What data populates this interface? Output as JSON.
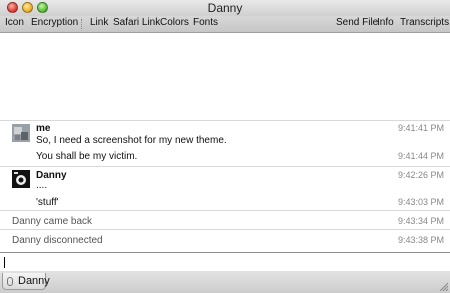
{
  "window": {
    "title": "Danny"
  },
  "toolbar": {
    "items": [
      "Icon",
      "Encryption",
      "Link",
      "Safari Link",
      "Colors",
      "Fonts",
      "Send File",
      "Info",
      "Transcripts"
    ]
  },
  "transcript": {
    "messages": [
      {
        "sender": "me",
        "lines": [
          "So, I need a screenshot for my new theme.",
          "You shall be my victim."
        ],
        "times": [
          "9:41:41 PM",
          "9:41:44 PM"
        ]
      },
      {
        "sender": "Danny",
        "lines": [
          "....",
          "'stuff'"
        ],
        "times": [
          "9:42:26 PM",
          "9:43:03 PM"
        ]
      }
    ],
    "status": [
      {
        "text": "Danny came back",
        "time": "9:43:34 PM"
      },
      {
        "text": "Danny disconnected",
        "time": "9:43:38 PM"
      }
    ]
  },
  "tabs": [
    {
      "label": "Danny"
    }
  ],
  "colors": {
    "separator": "#d9d9d9",
    "timestamp": "#888888"
  }
}
